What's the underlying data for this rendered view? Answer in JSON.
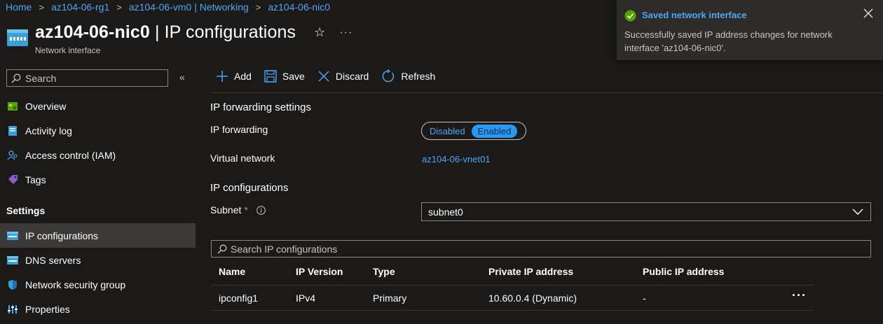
{
  "breadcrumb": [
    "Home",
    "az104-06-rg1",
    "az104-06-vm0 | Networking",
    "az104-06-nic0"
  ],
  "header": {
    "title_bold": "az104-06-nic0",
    "title_rest": " | IP configurations",
    "subtitle": "Network interface"
  },
  "sidebar": {
    "search_placeholder": "Search",
    "items": [
      {
        "label": "Overview",
        "icon": "overview-icon"
      },
      {
        "label": "Activity log",
        "icon": "activity-log-icon"
      },
      {
        "label": "Access control (IAM)",
        "icon": "iam-icon"
      },
      {
        "label": "Tags",
        "icon": "tag-icon"
      }
    ],
    "section": "Settings",
    "settings_items": [
      {
        "label": "IP configurations",
        "icon": "nic-icon",
        "active": true
      },
      {
        "label": "DNS servers",
        "icon": "dns-icon"
      },
      {
        "label": "Network security group",
        "icon": "shield-icon"
      },
      {
        "label": "Properties",
        "icon": "properties-icon"
      }
    ]
  },
  "toolbar": {
    "add": "Add",
    "save": "Save",
    "discard": "Discard",
    "refresh": "Refresh"
  },
  "main": {
    "ip_forwarding_section": "IP forwarding settings",
    "ip_forwarding_label": "IP forwarding",
    "toggle_off": "Disabled",
    "toggle_on": "Enabled",
    "toggle_selected": "Enabled",
    "vnet_label": "Virtual network",
    "vnet_value": "az104-06-vnet01",
    "ipconfig_section": "IP configurations",
    "subnet_label": "Subnet",
    "subnet_required": "*",
    "subnet_value": "subnet0",
    "ip_search_placeholder": "Search IP configurations",
    "columns": [
      "Name",
      "IP Version",
      "Type",
      "Private IP address",
      "Public IP address"
    ],
    "rows": [
      [
        "ipconfig1",
        "IPv4",
        "Primary",
        "10.60.0.4 (Dynamic)",
        "-"
      ]
    ]
  },
  "toast": {
    "title": "Saved network interface",
    "message": "Successfully saved IP address changes for network interface 'az104-06-nic0'."
  },
  "colors": {
    "background": "#1b1a19",
    "link": "#4ea6f5",
    "toggle_on": "#2899f5",
    "success": "#57a300",
    "active_nav": "#3b3a39"
  }
}
